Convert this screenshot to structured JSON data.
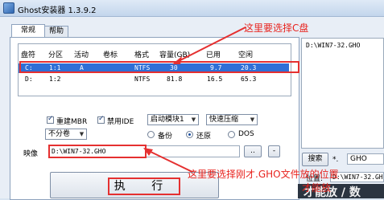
{
  "window": {
    "title": "Ghost安装器 1.3.9.2"
  },
  "tabs": [
    {
      "label": "常规"
    },
    {
      "label": "帮助"
    }
  ],
  "table": {
    "headers": [
      "盘符",
      "分区",
      "活动",
      "卷标",
      "格式",
      "容量(GB)",
      "已用",
      "空闲"
    ],
    "rows": [
      {
        "drive": "C:",
        "partition": "1:1",
        "active": "A",
        "label": "",
        "format": "NTFS",
        "capacity": "30",
        "used": "9.7",
        "free": "20.3"
      },
      {
        "drive": "D:",
        "partition": "1:2",
        "active": "",
        "label": "",
        "format": "NTFS",
        "capacity": "81.8",
        "used": "16.5",
        "free": "65.3"
      }
    ]
  },
  "annotations": {
    "top": "这里要选择C盘",
    "bottom": "这里要选择刚才.GHO文件放的位置",
    "bottom2": "才能放"
  },
  "options": {
    "rebuild_mbr": {
      "label": "重建MBR",
      "checked": true
    },
    "disable_ide": {
      "label": "禁用IDE",
      "checked": true
    },
    "boot_module": "启动模块1",
    "compression": "快速压缩",
    "split": "不分卷",
    "radio_backup": "备份",
    "radio_restore": "还原",
    "radio_dos": "DOS"
  },
  "image": {
    "label": "映像",
    "path": "D:\\WIN7-32.GHO",
    "browse_label": "..",
    "minus_label": "-"
  },
  "execute_label": "执 行",
  "right_panel": {
    "list_items": [
      "D:\\WIN7-32.GHO"
    ],
    "search_label": "搜索",
    "ext_label": "*.",
    "ext_value": "GHO",
    "position_label": "位置:",
    "position_value": "D:\\WIN7-32.GH",
    "overlay_text": "才能放 / 数"
  }
}
